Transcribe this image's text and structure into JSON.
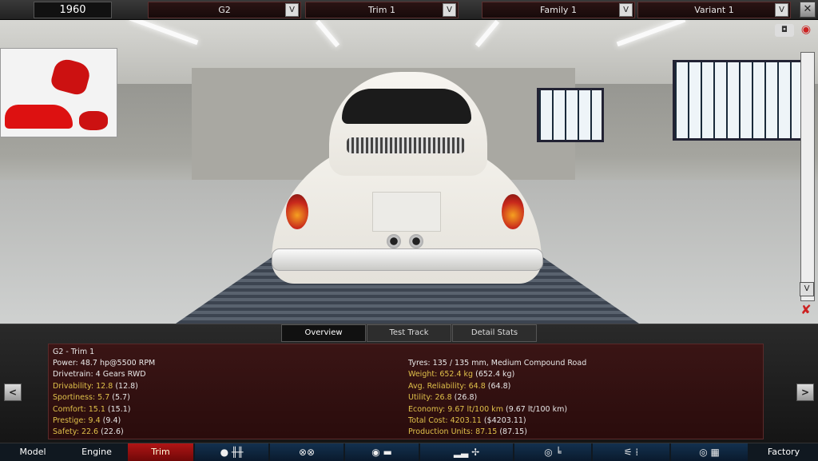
{
  "topbar": {
    "year": "1960",
    "model": "G2",
    "trim": "Trim 1",
    "family": "Family 1",
    "variant": "Variant 1",
    "dropdown_glyph": "V",
    "close_glyph": "✕"
  },
  "scene": {
    "scroll_down_glyph": "V",
    "camera_icon": "camera-icon",
    "eye_icon": "eye-icon",
    "delete_icon": "delete-icon"
  },
  "tabs": [
    "Overview",
    "Test Track",
    "Detail Stats"
  ],
  "stats": {
    "title": "G2 - Trim 1",
    "left": [
      {
        "label": "Power:",
        "value": "48.7 hp@5500 RPM",
        "highlight": false
      },
      {
        "label": "Drivetrain:",
        "value": "4 Gears RWD",
        "highlight": false
      },
      {
        "label": "Drivability:",
        "value": "12.8",
        "extra": "(12.8)",
        "highlight": true
      },
      {
        "label": "Sportiness:",
        "value": "5.7",
        "extra": "(5.7)",
        "highlight": true
      },
      {
        "label": "Comfort:",
        "value": "15.1",
        "extra": "(15.1)",
        "highlight": true
      },
      {
        "label": "Prestige:",
        "value": "9.4",
        "extra": "(9.4)",
        "highlight": true
      },
      {
        "label": "Safety:",
        "value": "22.6",
        "extra": "(22.6)",
        "highlight": true
      }
    ],
    "right": [
      {
        "label": "Tyres:",
        "value": "135 / 135 mm, Medium Compound Road",
        "highlight": false
      },
      {
        "label": "Weight:",
        "value": "652.4 kg",
        "extra": "(652.4 kg)",
        "highlight": true
      },
      {
        "label": "Avg. Reliability:",
        "value": "64.8",
        "extra": "(64.8)",
        "highlight": true
      },
      {
        "label": "Utility:",
        "value": "26.8",
        "extra": "(26.8)",
        "highlight": true
      },
      {
        "label": "Economy:",
        "value": "9.67 lt/100 km",
        "extra": "(9.67 lt/100 km)",
        "highlight": true
      },
      {
        "label": "Total Cost:",
        "value": "4203.11",
        "extra": "($4203.11)",
        "highlight": true
      },
      {
        "label": "Production Units:",
        "value": "87.15",
        "extra": "(87.15)",
        "highlight": true
      }
    ]
  },
  "arrows": {
    "left": "<",
    "right": ">"
  },
  "bottomnav": {
    "model": "Model",
    "engine": "Engine",
    "trim": "Trim",
    "factory": "Factory",
    "icons": [
      "chassis-gearbox-icon",
      "wheels-icon",
      "body-fixtures-icon",
      "aero-fan-icon",
      "interior-seat-icon",
      "suspension-icon",
      "test-flag-icon"
    ],
    "icon_glyphs": [
      "● ╫╫",
      "⊗⊗",
      "◉ ▬",
      "▂▃ ✢",
      "◎ ╘",
      "⚟ ⁞",
      "◎ ▦"
    ]
  },
  "colors": {
    "accent_red": "#b01515",
    "stat_highlight": "#e0c04a",
    "nav_blue": "#13314f"
  }
}
